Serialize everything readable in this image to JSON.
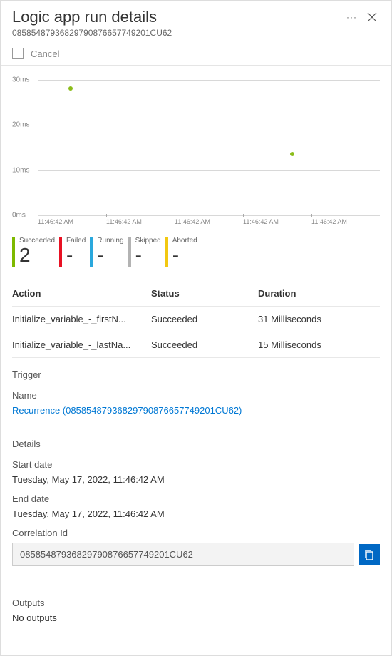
{
  "header": {
    "title": "Logic app run details",
    "run_id": "08585487936829790876657749201CU62"
  },
  "toolbar": {
    "cancel_label": "Cancel"
  },
  "chart_data": {
    "type": "scatter",
    "y_ticks": [
      "30ms",
      "20ms",
      "10ms",
      "0ms"
    ],
    "x_ticks": [
      "11:46:42 AM",
      "11:46:42 AM",
      "11:46:42 AM",
      "11:46:42 AM",
      "11:46:42 AM"
    ],
    "points": [
      {
        "x_frac": 0.1,
        "y_ms": 31
      },
      {
        "x_frac": 0.77,
        "y_ms": 15
      }
    ],
    "y_max": 33,
    "color": "#8bbd1a"
  },
  "status_summary": [
    {
      "label": "Succeeded",
      "count": "2",
      "color": "#7eb900"
    },
    {
      "label": "Failed",
      "count": "-",
      "color": "#e81123"
    },
    {
      "label": "Running",
      "count": "-",
      "color": "#2aa8dd"
    },
    {
      "label": "Skipped",
      "count": "-",
      "color": "#b3b3b3"
    },
    {
      "label": "Aborted",
      "count": "-",
      "color": "#f2c811"
    }
  ],
  "actions_table": {
    "headers": {
      "action": "Action",
      "status": "Status",
      "duration": "Duration"
    },
    "rows": [
      {
        "action": "Initialize_variable_-_firstN...",
        "status": "Succeeded",
        "duration": "31 Milliseconds"
      },
      {
        "action": "Initialize_variable_-_lastNa...",
        "status": "Succeeded",
        "duration": "15 Milliseconds"
      }
    ]
  },
  "trigger": {
    "heading": "Trigger",
    "name_label": "Name",
    "link_text": "Recurrence (08585487936829790876657749201CU62)"
  },
  "details": {
    "heading": "Details",
    "start_label": "Start date",
    "start_value": "Tuesday, May 17, 2022, 11:46:42 AM",
    "end_label": "End date",
    "end_value": "Tuesday, May 17, 2022, 11:46:42 AM",
    "corr_label": "Correlation Id",
    "corr_value": "08585487936829790876657749201CU62"
  },
  "outputs": {
    "heading": "Outputs",
    "value": "No outputs"
  }
}
